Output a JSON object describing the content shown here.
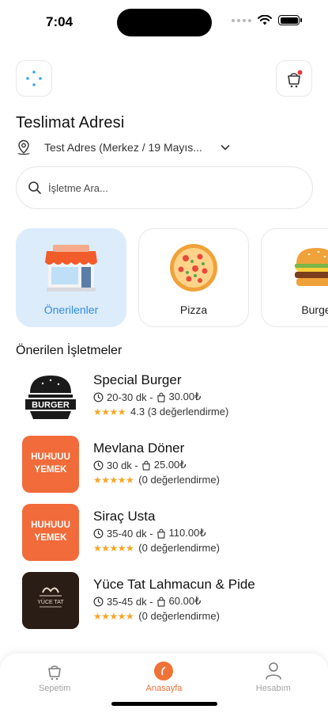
{
  "status_bar": {
    "time": "7:04"
  },
  "address": {
    "title": "Teslimat Adresi",
    "value": "Test Adres (Merkez / 19 Mayıs..."
  },
  "search": {
    "placeholder": "İşletme Ara..."
  },
  "categories": [
    {
      "label": "Önerilenler",
      "icon": "shop-icon",
      "active": true
    },
    {
      "label": "Pizza",
      "icon": "pizza-icon",
      "active": false
    },
    {
      "label": "Burge",
      "icon": "burger-icon",
      "active": false
    }
  ],
  "section_title": "Önerilen İşletmeler",
  "restaurants": [
    {
      "name": "Special Burger",
      "time": "20-30 dk -",
      "min_order": "30.00₺",
      "rating": "4.3 (3 değerlendirme)",
      "logo_text": "BURGER"
    },
    {
      "name": "Mevlana Döner",
      "time": "30 dk -",
      "min_order": "25.00₺",
      "rating": "(0 değerlendirme)",
      "logo_text": "HUHUUU YEMEK"
    },
    {
      "name": "Siraç Usta",
      "time": "35-40 dk -",
      "min_order": "110.00₺",
      "rating": "(0 değerlendirme)",
      "logo_text": "HUHUUU YEMEK"
    },
    {
      "name": "Yüce Tat Lahmacun & Pide",
      "time": "35-45 dk -",
      "min_order": "60.00₺",
      "rating": "(0 değerlendirme)",
      "logo_text": "YÜCE TAT"
    }
  ],
  "bottom_nav": [
    {
      "label": "Sepetim",
      "icon": "basket-icon",
      "active": false
    },
    {
      "label": "Anasayfa",
      "icon": "home-icon",
      "active": true
    },
    {
      "label": "Hesabım",
      "icon": "user-icon",
      "active": false
    }
  ],
  "colors": {
    "accent": "#f07237",
    "active_category_bg": "#dcecfb",
    "active_category_text": "#2e8ce6",
    "star": "#f5a623"
  }
}
